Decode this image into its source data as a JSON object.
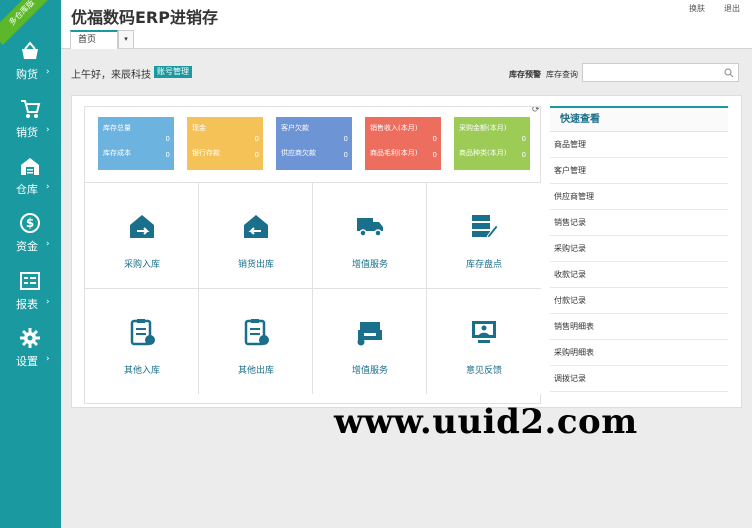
{
  "app": {
    "title": "优福数码ERP进销存",
    "ribbon": "多仓库版"
  },
  "header": {
    "switch": "换肤",
    "logout": "退出",
    "tab_home": "首页",
    "tab_menu": "▾"
  },
  "sidebar": {
    "items": [
      {
        "label": "购货",
        "icon": "basket-icon"
      },
      {
        "label": "销货",
        "icon": "cart-icon"
      },
      {
        "label": "仓库",
        "icon": "warehouse-icon"
      },
      {
        "label": "资金",
        "icon": "dollar-icon"
      },
      {
        "label": "报表",
        "icon": "report-icon"
      },
      {
        "label": "设置",
        "icon": "gear-icon"
      }
    ],
    "arrow": "›"
  },
  "toolbar": {
    "greeting": "上午好，来辰科技",
    "account_button": "账号管理",
    "warning_label": "库存预警",
    "query_label": "库存查询",
    "search_placeholder": ""
  },
  "stats": [
    {
      "label1": "库存总量",
      "value1": "0",
      "label2": "库存成本",
      "value2": "0",
      "color": "#6cb3e0"
    },
    {
      "label1": "现金",
      "value1": "0",
      "label2": "银行存款",
      "value2": "0",
      "color": "#f5c258"
    },
    {
      "label1": "客户欠款",
      "value1": "0",
      "label2": "供应商欠款",
      "value2": "0",
      "color": "#6d95d6"
    },
    {
      "label1": "销售收入(本月)",
      "value1": "0",
      "label2": "商品毛利(本月)",
      "value2": "0",
      "color": "#ed6e5f"
    },
    {
      "label1": "采购金额(本月)",
      "value1": "0",
      "label2": "商品种类(本月)",
      "value2": "0",
      "color": "#9ccb56"
    }
  ],
  "tiles": [
    {
      "label": "采购入库",
      "icon": "purchase-in-icon"
    },
    {
      "label": "销货出库",
      "icon": "sales-out-icon"
    },
    {
      "label": "增值服务",
      "icon": "truck-icon"
    },
    {
      "label": "库存盘点",
      "icon": "inventory-check-icon"
    },
    {
      "label": "其他入库",
      "icon": "other-in-icon"
    },
    {
      "label": "其他出库",
      "icon": "other-out-icon"
    },
    {
      "label": "增值服务",
      "icon": "printer-icon"
    },
    {
      "label": "意见反馈",
      "icon": "feedback-icon"
    }
  ],
  "quick": {
    "title": "快速查看",
    "links": [
      "商品管理",
      "客户管理",
      "供应商管理",
      "销售记录",
      "采购记录",
      "收款记录",
      "付款记录",
      "销售明细表",
      "采购明细表",
      "调拨记录"
    ]
  },
  "watermark": "www.uuid2.com",
  "colors": {
    "sidebar": "#1a9aa0",
    "accent": "#1a9aa0",
    "tile_icon": "#1a6f8a"
  }
}
